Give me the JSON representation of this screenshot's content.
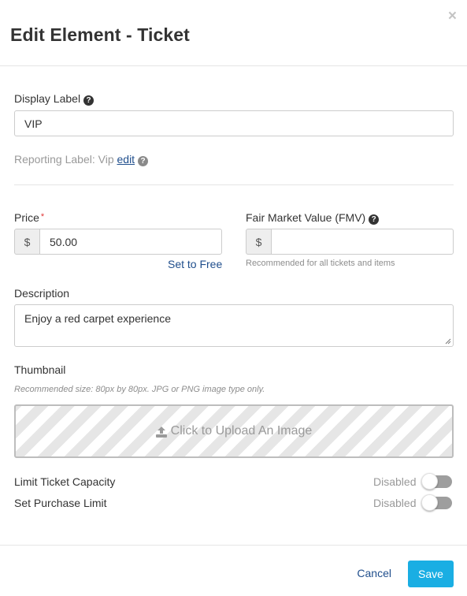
{
  "header": {
    "title": "Edit Element - Ticket",
    "close_glyph": "×"
  },
  "display_label": {
    "label": "Display Label",
    "value": "VIP",
    "help_icon": "question-circle-icon"
  },
  "reporting": {
    "prefix": "Reporting Label: Vip",
    "edit_link": "edit"
  },
  "price": {
    "label": "Price",
    "required_mark": "*",
    "currency": "$",
    "value": "50.00",
    "set_free_link": "Set to Free"
  },
  "fmv": {
    "label": "Fair Market Value (FMV)",
    "currency": "$",
    "value": "",
    "help": "Recommended for all tickets and items"
  },
  "description": {
    "label": "Description",
    "value": "Enjoy a red carpet experience"
  },
  "thumbnail": {
    "label": "Thumbnail",
    "help": "Recommended size: 80px by 80px. JPG or PNG image type only.",
    "upload_text": "Click to Upload An Image",
    "upload_icon": "upload-icon"
  },
  "limits": [
    {
      "label": "Limit Ticket Capacity",
      "state": "Disabled",
      "enabled": false
    },
    {
      "label": "Set Purchase Limit",
      "state": "Disabled",
      "enabled": false
    }
  ],
  "footer": {
    "cancel": "Cancel",
    "save": "Save"
  },
  "colors": {
    "primary": "#1aaee3",
    "link": "#1f4e8c",
    "required": "#e03535"
  }
}
